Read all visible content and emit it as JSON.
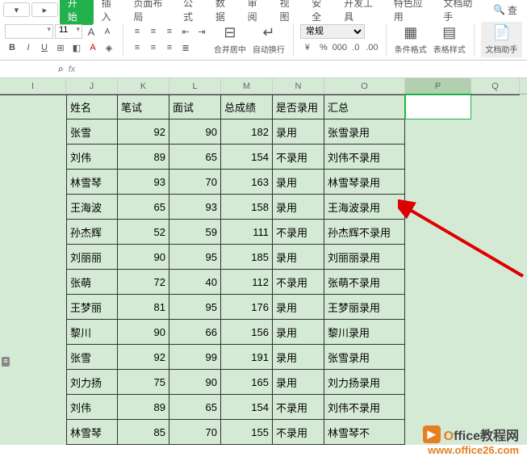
{
  "tabs": {
    "start": "开始",
    "insert": "插入",
    "layout": "页面布局",
    "formula": "公式",
    "data": "数据",
    "review": "审阅",
    "view": "视图",
    "security": "安全",
    "dev": "开发工具",
    "special": "特色应用",
    "dochelper": "文档助手",
    "search": "查"
  },
  "toolbar": {
    "font_size": "11",
    "bold": "B",
    "italic": "I",
    "underline": "U",
    "font_up": "A",
    "font_down": "A",
    "merge": "合并居中",
    "wrap": "自动换行",
    "format_general": "常规",
    "cond_format": "条件格式",
    "table_style": "表格样式",
    "doc_helper": "文档助手"
  },
  "formula_bar": {
    "fx": "fx"
  },
  "columns": {
    "I": "I",
    "J": "J",
    "K": "K",
    "L": "L",
    "M": "M",
    "N": "N",
    "O": "O",
    "P": "P",
    "Q": "Q"
  },
  "headers": {
    "name": "姓名",
    "written": "笔试",
    "interview": "面试",
    "total": "总成绩",
    "hired": "是否录用",
    "summary": "汇总"
  },
  "rows": [
    {
      "name": "张雪",
      "written": "92",
      "interview": "90",
      "total": "182",
      "hired": "录用",
      "summary": "张雪录用"
    },
    {
      "name": "刘伟",
      "written": "89",
      "interview": "65",
      "total": "154",
      "hired": "不录用",
      "summary": "刘伟不录用"
    },
    {
      "name": "林雪琴",
      "written": "93",
      "interview": "70",
      "total": "163",
      "hired": "录用",
      "summary": "林雪琴录用"
    },
    {
      "name": "王海波",
      "written": "65",
      "interview": "93",
      "total": "158",
      "hired": "录用",
      "summary": "王海波录用"
    },
    {
      "name": "孙杰辉",
      "written": "52",
      "interview": "59",
      "total": "111",
      "hired": "不录用",
      "summary": "孙杰辉不录用"
    },
    {
      "name": "刘丽丽",
      "written": "90",
      "interview": "95",
      "total": "185",
      "hired": "录用",
      "summary": "刘丽丽录用"
    },
    {
      "name": "张萌",
      "written": "72",
      "interview": "40",
      "total": "112",
      "hired": "不录用",
      "summary": "张萌不录用"
    },
    {
      "name": "王梦丽",
      "written": "81",
      "interview": "95",
      "total": "176",
      "hired": "录用",
      "summary": "王梦丽录用"
    },
    {
      "name": "黎川",
      "written": "90",
      "interview": "66",
      "total": "156",
      "hired": "录用",
      "summary": "黎川录用"
    },
    {
      "name": "张雪",
      "written": "92",
      "interview": "99",
      "total": "191",
      "hired": "录用",
      "summary": "张雪录用"
    },
    {
      "name": "刘力扬",
      "written": "75",
      "interview": "90",
      "total": "165",
      "hired": "录用",
      "summary": "刘力扬录用"
    },
    {
      "name": "刘伟",
      "written": "89",
      "interview": "65",
      "total": "154",
      "hired": "不录用",
      "summary": "刘伟不录用"
    },
    {
      "name": "林雪琴",
      "written": "85",
      "interview": "70",
      "total": "155",
      "hired": "不录用",
      "summary": "林雪琴不"
    }
  ],
  "watermark": {
    "brand_o": "O",
    "brand_rest": "ffice教程网",
    "url": "www.office26.com"
  }
}
